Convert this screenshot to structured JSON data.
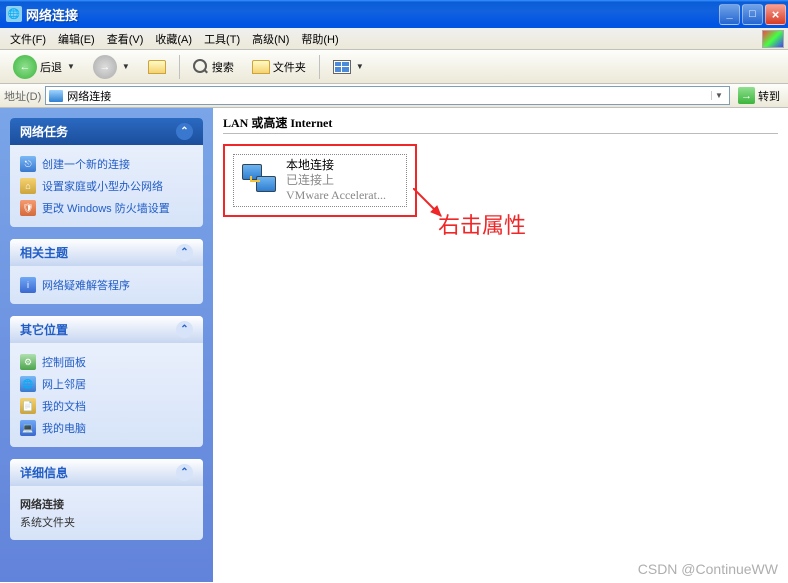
{
  "window": {
    "title": "网络连接"
  },
  "menu": {
    "items": [
      "文件(F)",
      "编辑(E)",
      "查看(V)",
      "收藏(A)",
      "工具(T)",
      "高级(N)",
      "帮助(H)"
    ]
  },
  "toolbar": {
    "back": "后退",
    "search": "搜索",
    "folders": "文件夹"
  },
  "address": {
    "label": "地址(D)",
    "value": "网络连接",
    "go": "转到"
  },
  "panels": {
    "tasks": {
      "title": "网络任务",
      "items": [
        "创建一个新的连接",
        "设置家庭或小型办公网络",
        "更改 Windows 防火墙设置"
      ]
    },
    "related": {
      "title": "相关主题",
      "items": [
        "网络疑难解答程序"
      ]
    },
    "other": {
      "title": "其它位置",
      "items": [
        "控制面板",
        "网上邻居",
        "我的文档",
        "我的电脑"
      ]
    },
    "details": {
      "title": "详细信息",
      "name": "网络连接",
      "type": "系统文件夹"
    }
  },
  "main": {
    "category": "LAN 或高速 Internet",
    "conn": {
      "name": "本地连接",
      "status": "已连接上",
      "device": "VMware Accelerat..."
    }
  },
  "annotation": "右击属性",
  "watermark": "CSDN @ContinueWW"
}
